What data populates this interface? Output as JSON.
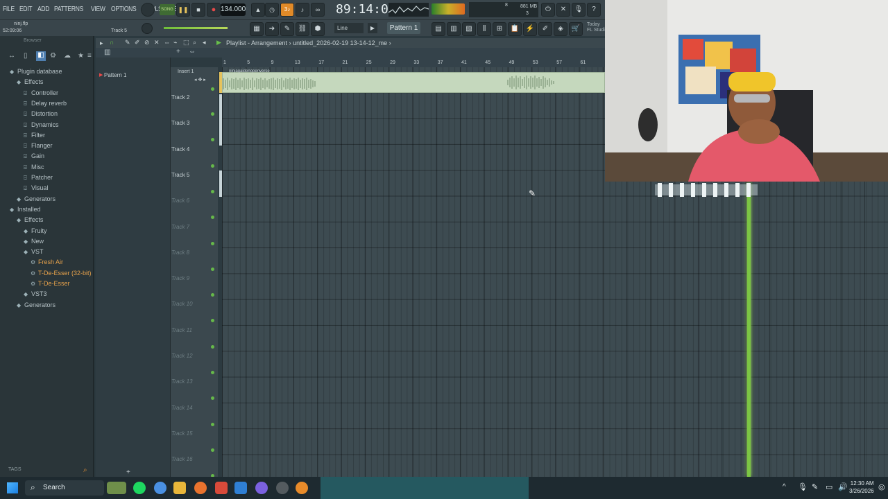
{
  "menu": [
    "FILE",
    "EDIT",
    "ADD",
    "PATTERNS",
    "VIEW",
    "OPTIONS",
    "TOOLS",
    "HELP"
  ],
  "transport": {
    "song_label": "SONG",
    "tempo": "134.000",
    "time": "89:14:05",
    "cpu_mem": "881 MB",
    "cpu_a": "8",
    "cpu_b": "3"
  },
  "project": {
    "file_name": "ninj.flp",
    "elapsed": "52:09:06",
    "selected_track": "Track 5",
    "snap": "Line",
    "pattern": "Pattern 1",
    "today_label": "Today",
    "studio_label": "FL Studi"
  },
  "browser": {
    "title": "Browser",
    "tree": [
      {
        "label": "Plugin database",
        "level": 0,
        "icon": "folder-icon"
      },
      {
        "label": "Effects",
        "level": 1,
        "icon": "folder-icon"
      },
      {
        "label": "Controller",
        "level": 2,
        "icon": "plug-icon"
      },
      {
        "label": "Delay reverb",
        "level": 2,
        "icon": "plug-icon"
      },
      {
        "label": "Distortion",
        "level": 2,
        "icon": "plug-icon"
      },
      {
        "label": "Dynamics",
        "level": 2,
        "icon": "plug-icon"
      },
      {
        "label": "Filter",
        "level": 2,
        "icon": "plug-icon"
      },
      {
        "label": "Flanger",
        "level": 2,
        "icon": "plug-icon"
      },
      {
        "label": "Gain",
        "level": 2,
        "icon": "plug-icon"
      },
      {
        "label": "Misc",
        "level": 2,
        "icon": "plug-icon"
      },
      {
        "label": "Patcher",
        "level": 2,
        "icon": "plug-icon"
      },
      {
        "label": "Visual",
        "level": 2,
        "icon": "plug-icon"
      },
      {
        "label": "Generators",
        "level": 1,
        "icon": "folder-icon"
      },
      {
        "label": "Installed",
        "level": 0,
        "icon": "folder-icon"
      },
      {
        "label": "Effects",
        "level": 1,
        "icon": "folder-icon"
      },
      {
        "label": "Fruity",
        "level": 2,
        "icon": "folder-icon"
      },
      {
        "label": "New",
        "level": 2,
        "icon": "folder-icon"
      },
      {
        "label": "VST",
        "level": 2,
        "icon": "folder-icon"
      },
      {
        "label": "Fresh Air",
        "level": 3,
        "icon": "plugin-gear-icon",
        "highlight": true
      },
      {
        "label": "T-De-Esser (32-bit)",
        "level": 3,
        "icon": "plugin-gear-icon",
        "highlight": true
      },
      {
        "label": "T-De-Esser",
        "level": 3,
        "icon": "plugin-gear-icon",
        "highlight": true
      },
      {
        "label": "VST3",
        "level": 2,
        "icon": "folder-icon"
      },
      {
        "label": "Generators",
        "level": 1,
        "icon": "folder-icon"
      }
    ],
    "tags_label": "TAGS"
  },
  "playlist": {
    "title": "Playlist - Arrangement",
    "breadcrumb": "untitled_2026-02-19 13-14-12_me",
    "pattern_list": [
      "Pattern 1"
    ],
    "insert_label": "Insert 1",
    "clip_name": "ninjagaidenopenverse",
    "ruler_ticks": [
      "1",
      "5",
      "9",
      "13",
      "17",
      "21",
      "25",
      "29",
      "33",
      "37",
      "41",
      "45",
      "49",
      "53",
      "57",
      "61"
    ],
    "tracks": [
      "Track 2",
      "Track 3",
      "Track 4",
      "Track 5",
      "Track 6",
      "Track 7",
      "Track 8",
      "Track 9",
      "Track 10",
      "Track 11",
      "Track 12",
      "Track 13",
      "Track 14",
      "Track 15",
      "Track 16"
    ]
  },
  "taskbar": {
    "search_placeholder": "Search",
    "time": "12:30 AM",
    "date": "3/26/2026"
  }
}
